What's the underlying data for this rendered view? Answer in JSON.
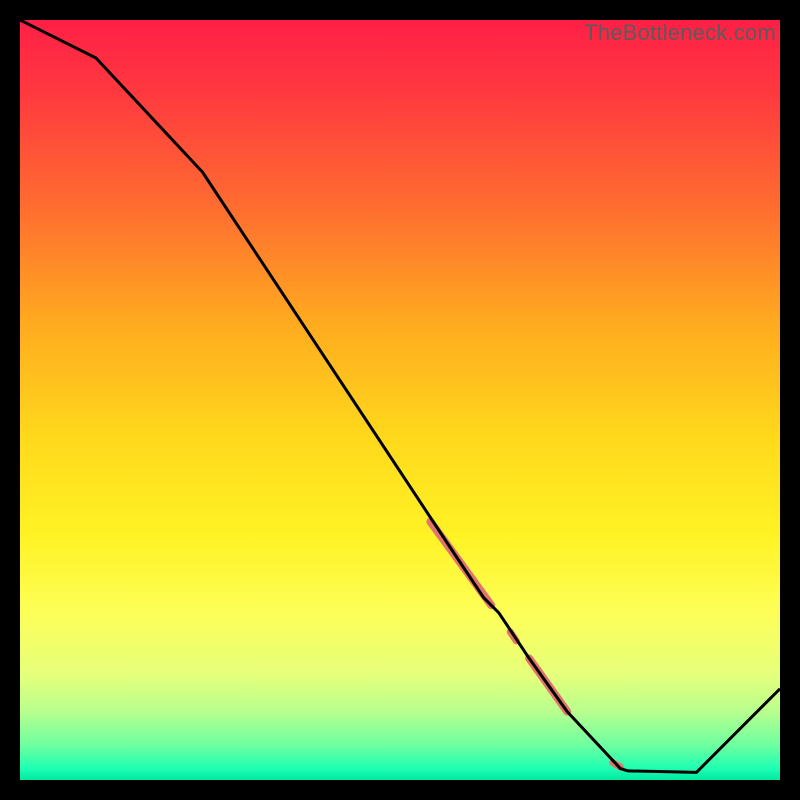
{
  "watermark": "TheBottleneck.com",
  "gradient_stops": [
    {
      "offset": 0.0,
      "color": "#ff1f46"
    },
    {
      "offset": 0.1,
      "color": "#ff3a3f"
    },
    {
      "offset": 0.25,
      "color": "#ff6e2f"
    },
    {
      "offset": 0.4,
      "color": "#ffab1f"
    },
    {
      "offset": 0.55,
      "color": "#ffd91c"
    },
    {
      "offset": 0.68,
      "color": "#fff325"
    },
    {
      "offset": 0.78,
      "color": "#fdff58"
    },
    {
      "offset": 0.86,
      "color": "#e6ff7a"
    },
    {
      "offset": 0.91,
      "color": "#b8ff8e"
    },
    {
      "offset": 0.955,
      "color": "#6cffa0"
    },
    {
      "offset": 0.985,
      "color": "#1dffb3"
    },
    {
      "offset": 1.0,
      "color": "#00e8a0"
    }
  ],
  "chart_data": {
    "type": "line",
    "title": "",
    "xlabel": "",
    "ylabel": "",
    "xlim": [
      0,
      100
    ],
    "ylim": [
      0,
      100
    ],
    "series": [
      {
        "name": "curve",
        "x": [
          0,
          10,
          24,
          57,
          61,
          63,
          67,
          72,
          79,
          80,
          89,
          100
        ],
        "values": [
          100,
          95,
          80,
          30,
          24,
          22,
          16,
          9,
          1.5,
          1.2,
          1.0,
          12
        ]
      }
    ],
    "highlight_segments": [
      {
        "x0": 54,
        "y0": 34,
        "x1": 62,
        "y1": 23,
        "w": 8
      },
      {
        "x0": 64.5,
        "y0": 19.5,
        "x1": 65.3,
        "y1": 18.3,
        "w": 7
      },
      {
        "x0": 67,
        "y0": 16,
        "x1": 72,
        "y1": 9,
        "w": 8
      },
      {
        "x0": 78,
        "y0": 2.3,
        "x1": 79,
        "y1": 1.7,
        "w": 7
      }
    ],
    "highlight_color": "#e2746e"
  }
}
